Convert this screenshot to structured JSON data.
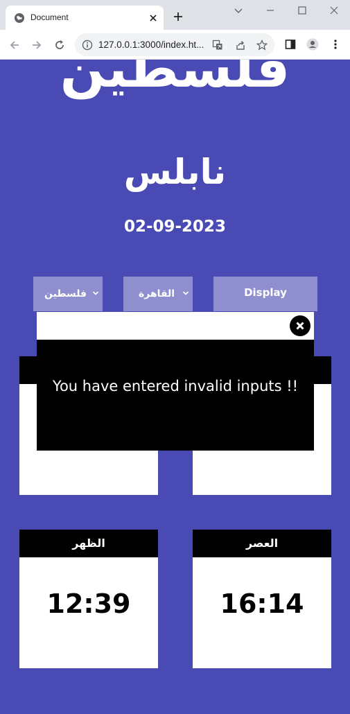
{
  "browser": {
    "tab_title": "Document",
    "url": "127.0.0.1:3000/index.ht..."
  },
  "page": {
    "country_title": "فلسطين",
    "city_title": "نابلس",
    "date": "02-09-2023",
    "country_select": "فلسطين",
    "city_select": "القاهرة",
    "display_label": "Display"
  },
  "cards": [
    {
      "name": "الظهر",
      "time": "12:39"
    },
    {
      "name": "العصر",
      "time": "16:14"
    }
  ],
  "modal": {
    "message": "You have entered invalid inputs !!"
  },
  "colors": {
    "page_bg": "#4a4ab5",
    "control_bg": "#8f8fd0",
    "card_header": "#000000"
  }
}
